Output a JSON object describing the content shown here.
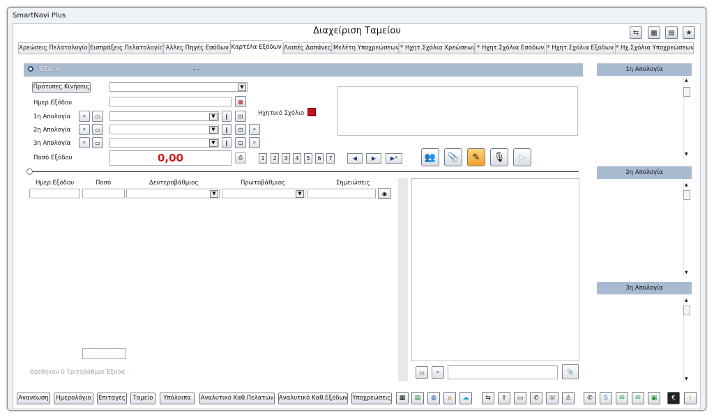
{
  "window": {
    "title": "SmartNavi Plus"
  },
  "main": {
    "title": "Διαχείριση Ταμείου"
  },
  "top_icons": [
    "user-transfer-icon",
    "calculator-icon",
    "grid-icon",
    "star-icon"
  ],
  "tabs": [
    {
      "label": "Χρεώσεις Πελατολογίου",
      "active": false
    },
    {
      "label": "Εισπράξεις Πελατολογίου",
      "active": false
    },
    {
      "label": "'Αλλες Πηγές Εσόδων",
      "active": false
    },
    {
      "label": "Καρτέλα Εξόδων",
      "active": true
    },
    {
      "label": "Λοιπές Δαπάνες",
      "active": false
    },
    {
      "label": "Μελέτη Υποχρεώσεων",
      "active": false
    },
    {
      "label": "* Ηχητ.Σχόλια Χρεώσεων",
      "active": false
    },
    {
      "label": "* Ηχητ.Σχόλια Εσόδων",
      "active": false
    },
    {
      "label": "* Ηχητ.Σχόλια Εξόδων",
      "active": false
    },
    {
      "label": "* Ηχ.Σχόλια Υποχρεώσεων",
      "active": false
    }
  ],
  "section": {
    "title": "'Εξοδα",
    "dashes": "- -"
  },
  "form": {
    "prev_button": "Πρότυπες Κινήσεις",
    "date_label": "Ημερ.Εξόδου",
    "receipt1_label": "1η Απολογία",
    "receipt2_label": "2η Απολογία",
    "receipt3_label": "3η Απολογία",
    "amount_label": "Ποσό Εξόδου",
    "amount_value": "0,00",
    "voice_label": "Ηχητικό Σχόλιο",
    "pages": [
      "1",
      "2",
      "3",
      "4",
      "5",
      "6",
      "7"
    ]
  },
  "table": {
    "headers": [
      "Ημερ.Εξόδου",
      "Ποσό",
      "Δευτεροβάθμιος",
      "Πρωτοβάθμιος",
      "Σημειώσεις"
    ]
  },
  "status_text": "Βρέθηκαν  0 Τριτοβάθμια Έξοδα -",
  "right": {
    "receipt1": "1η Απολογία",
    "receipt2": "2η Απολογία",
    "receipt3": "3η Απολογία"
  },
  "bottom_buttons": [
    "Ανανέωση",
    "Ημερολόγιο",
    "Επιταγές",
    "Ταμείο",
    "Υπόλοιπα",
    "Αναλυτικό Καθ.Πελατών",
    "Αναλυτικό Καθ.Εξόδων",
    "Υποχρεώσεις"
  ],
  "colors": {
    "section_bg": "#a7bad0",
    "amount": "#d01818",
    "panel_border": "#c4c9d0"
  }
}
